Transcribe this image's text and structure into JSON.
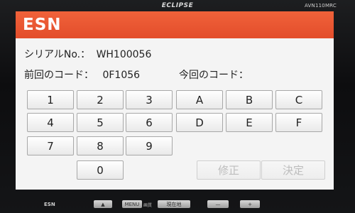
{
  "device": {
    "brand": "ECLIPSE",
    "model": "AVN110MRC",
    "small_logo": "ESN"
  },
  "screen": {
    "title": "ESN",
    "serial_label": "シリアルNo.：",
    "serial_value": "WH100056",
    "prev_code_label": "前回のコード：",
    "prev_code_value": "0F1056",
    "curr_code_label": "今回のコード：",
    "curr_code_value": ""
  },
  "keypad": {
    "k1": "1",
    "k2": "2",
    "k3": "3",
    "kA": "A",
    "kB": "B",
    "kC": "C",
    "k4": "4",
    "k5": "5",
    "k6": "6",
    "kD": "D",
    "kE": "E",
    "kF": "F",
    "k7": "7",
    "k8": "8",
    "k9": "9",
    "k0": "0",
    "fix": "修正",
    "confirm": "決定"
  },
  "hardware": {
    "eject": "▲",
    "menu": "MENU",
    "quality_label": "画質",
    "current_location": "現在地",
    "minus": "—",
    "plus": "+"
  }
}
